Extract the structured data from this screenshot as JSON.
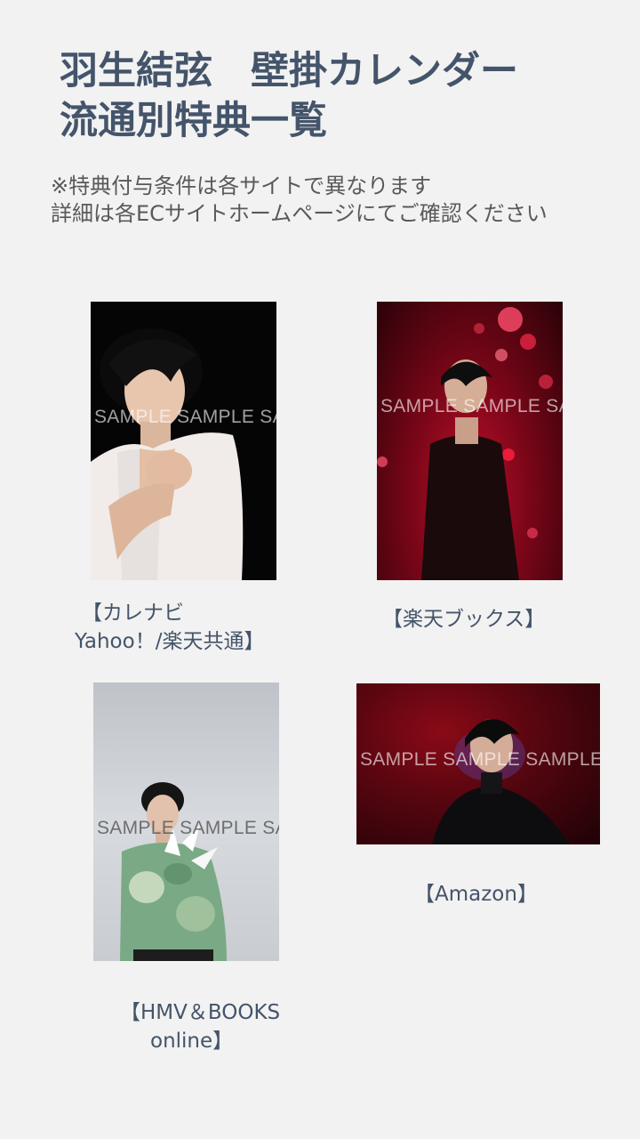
{
  "title": {
    "line1": "羽生結弦　壁掛カレンダー",
    "line2": "流通別特典一覧"
  },
  "note": {
    "line1": "※特典付与条件は各サイトで異なります",
    "line2": "詳細は各ECサイトホームページにてご確認ください"
  },
  "items": [
    {
      "watermark": "SAMPLE  SAMPLE  SAMPLE",
      "caption_line1": "【カレナビ",
      "caption_line2": "Yahoo！/楽天共通】"
    },
    {
      "watermark": "SAMPLE  SAMPLE  SAMPLE",
      "caption_line1": "【楽天ブックス】"
    },
    {
      "watermark": "SAMPLE  SAMPLE  SAMPLE",
      "caption_line1": "【HMV＆BOOKS",
      "caption_line2": "online】"
    },
    {
      "watermark": "SAMPLE  SAMPLE  SAMPLE  SAMPLE  SAMPLE",
      "caption_line1": "【Amazon】"
    }
  ],
  "colors": {
    "background": "#f2f2f2",
    "heading": "#44546a",
    "note": "#595959"
  }
}
